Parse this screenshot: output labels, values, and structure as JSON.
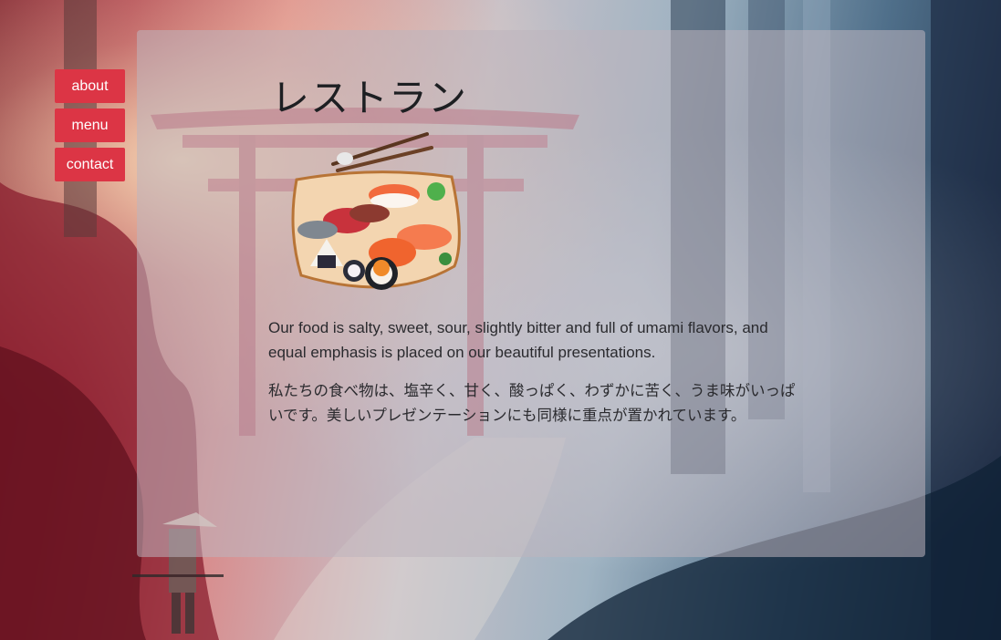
{
  "nav": {
    "items": [
      {
        "label": "about"
      },
      {
        "label": "menu"
      },
      {
        "label": "contact"
      }
    ]
  },
  "page": {
    "title": "レストラン",
    "description_en": "Our food is salty, sweet, sour, slightly bitter and full of umami flavors, and equal emphasis is placed on our beautiful presentations.",
    "description_jp": "私たちの食べ物は、塩辛く、甘く、酸っぱく、わずかに苦く、うま味がいっぱいです。美しいプレゼンテーションにも同様に重点が置かれています。"
  },
  "images": {
    "hero": "sushi-platter-illustration",
    "background": "torii-gate-forest-painting"
  },
  "colors": {
    "button": "#dc3545",
    "button_text": "#ffffff",
    "title": "#1d1f22",
    "body_text": "#2a2a2e"
  }
}
